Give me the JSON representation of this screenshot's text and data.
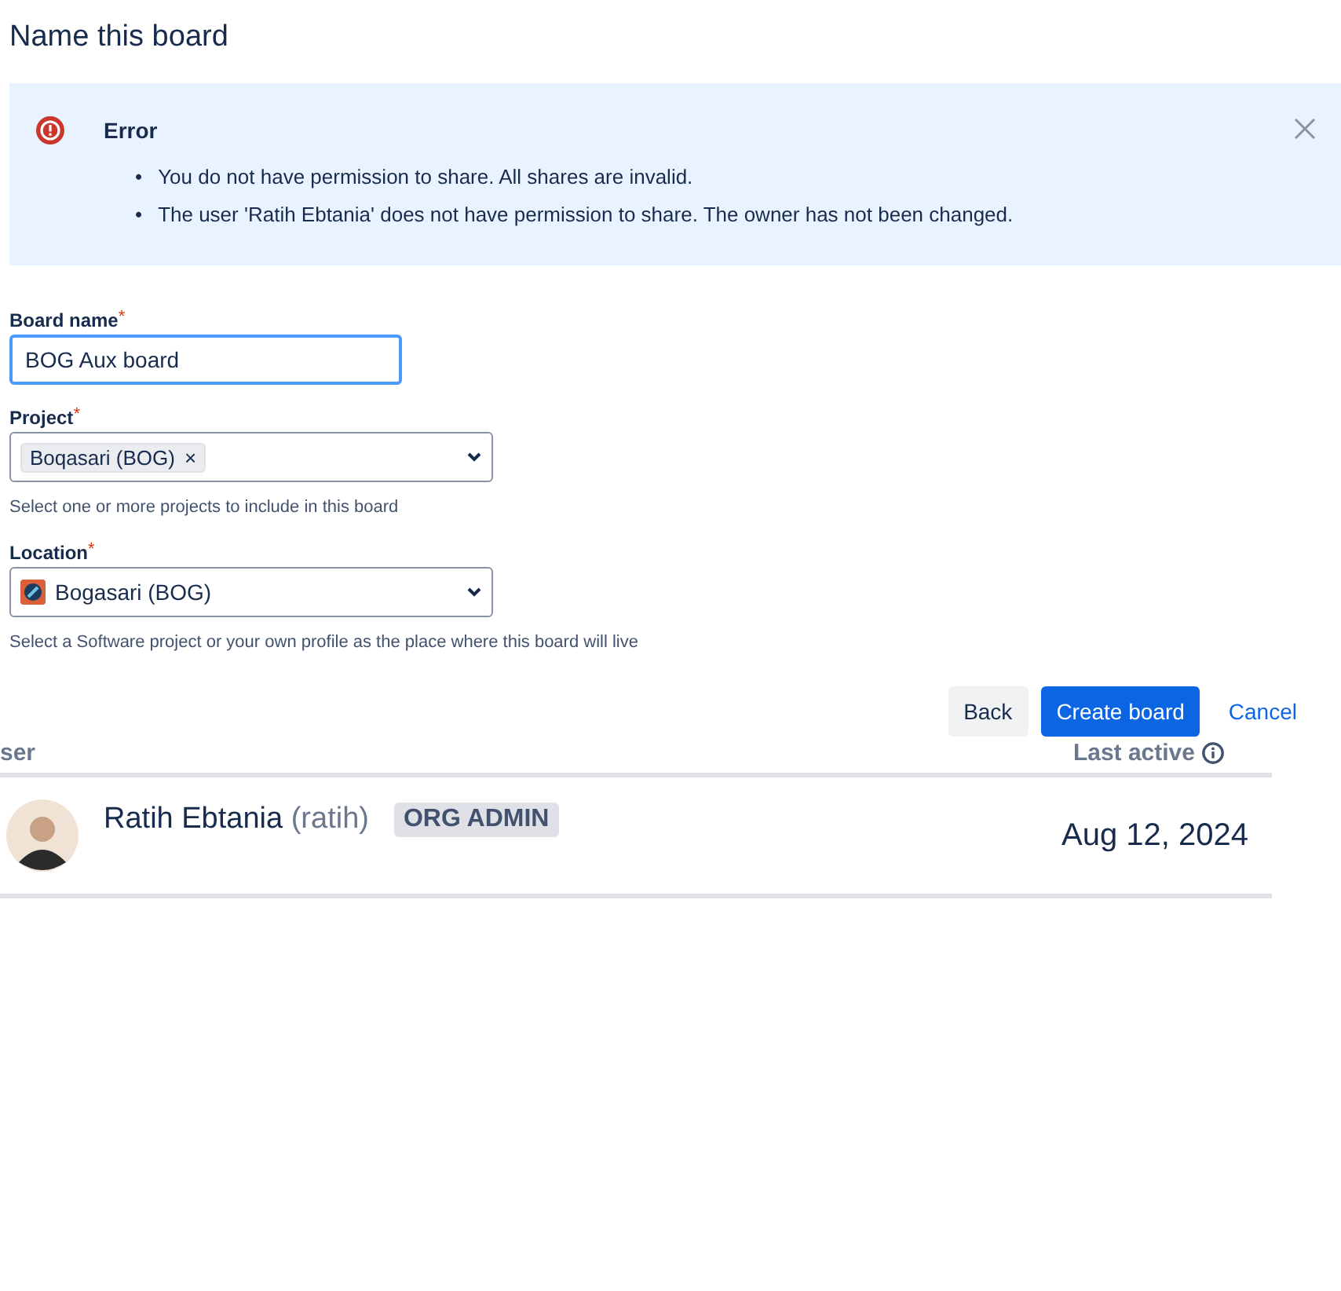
{
  "title": "Name this board",
  "error": {
    "title": "Error",
    "bullet": "•",
    "messages": [
      "You do not have permission to share. All shares are invalid.",
      "The user 'Ratih Ebtania' does not have permission to share. The owner has not been changed."
    ]
  },
  "fields": [
    {
      "kind": "text",
      "label": "Board name",
      "required_mark": "*",
      "value": "BOG Aux board",
      "focused": true
    },
    {
      "kind": "multi",
      "label": "Project",
      "required_mark": "*",
      "tags": [
        {
          "label": "Boqasari (BOG)",
          "remove": "×"
        }
      ],
      "help": "Select one or more projects to include in this board"
    },
    {
      "kind": "single",
      "label": "Location",
      "required_mark": "*",
      "value": "Bogasari (BOG)",
      "help": "Select a Software project or your own profile as the place where this board will live"
    }
  ],
  "buttons": [
    {
      "label": "Back",
      "kind": "subtle"
    },
    {
      "label": "Create board",
      "kind": "primary"
    },
    {
      "label": "Cancel",
      "kind": "link"
    }
  ],
  "table": {
    "columns": [
      "ser",
      "Last active"
    ],
    "rows": [
      {
        "name": "Ratih Ebtania",
        "username": "(ratih)",
        "badge": "ORG ADMIN",
        "last_active": "Aug 12, 2024"
      }
    ]
  }
}
